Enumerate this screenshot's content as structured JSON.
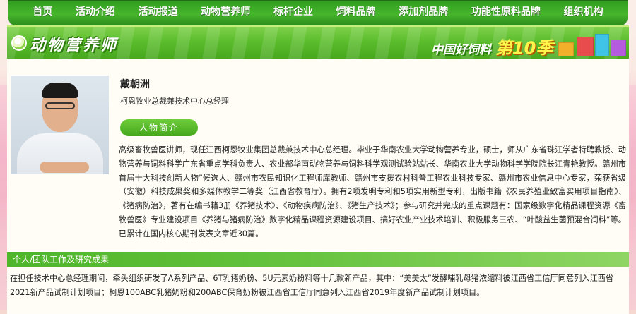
{
  "nav": {
    "items": [
      {
        "label": "首页"
      },
      {
        "label": "活动介绍"
      },
      {
        "label": "活动报道"
      },
      {
        "label": "动物营养师"
      },
      {
        "label": "标杆企业"
      },
      {
        "label": "饲料品牌"
      },
      {
        "label": "添加剂品牌"
      },
      {
        "label": "功能性原料品牌"
      },
      {
        "label": "组织机构"
      }
    ]
  },
  "banner": {
    "title": "动物营养师",
    "campaign": "中国好饲料",
    "season": "第10季"
  },
  "profile": {
    "name": "戴朝洲",
    "position": "柯恩牧业总裁兼技术中心总经理",
    "section_label": "人物简介",
    "bio": "高级畜牧兽医讲师，现任江西柯恩牧业集团总裁兼技术中心总经理。毕业于华南农业大学动物营养专业，硕士，师从广东省珠江学者特聘教授、动物营养与饲料科学广东省重点学科负责人、农业部华南动物营养与饲料科学观测试验站站长、华南农业大学动物科学学院院长江青艳教授。赣州市首届十大科技创新人物”候选人、赣州市农民知识化工程师库教师、赣州市支援农村科普工程农业科技专家、赣州市农业信息中心专家，荣获省级（安徽）科技成果奖和多媒体教学二等奖（江西省教育厅）。拥有2项发明专利和5项实用新型专利，出版书籍《农民养殖业致富实用项目指南》、《猪病防治》，著有在编书籍3册《养猪技术》、《动物疾病防治》、《猪生产技术》；参与研究并完成的重点课题有：国家级数字化精品课程资源《畜牧兽医》专业建设项目《养猪与猪病防治》数字化精品课程资源建设项目、搞好农业产业技术培训、积极服务三农、“叶酸益生菌预混合饲料”等。已累计在国内核心期刊发表文章近30篇。"
  },
  "work": {
    "section_label": "个人/团队工作及研究成果",
    "text": "在担任技术中心总经理期间，牵头组织研发了A系列产品、6T乳猪奶粉、5U元素奶粉料等十几款新产品，其中：“美美太”发酵哺乳母猪浓缩料被江西省工信厅同意列入江西省2021新产品试制计划项目；柯恩100ABC乳猪奶粉和200ABC保育奶粉被江西省工信厅同意列入江西省2019年度新产品试制计划项目。"
  },
  "colors": {
    "nav_green": "#3aa624",
    "banner_green": "#5bbd2c",
    "pill_green": "#4fb52a",
    "page_pink": "#f7dcd6"
  }
}
